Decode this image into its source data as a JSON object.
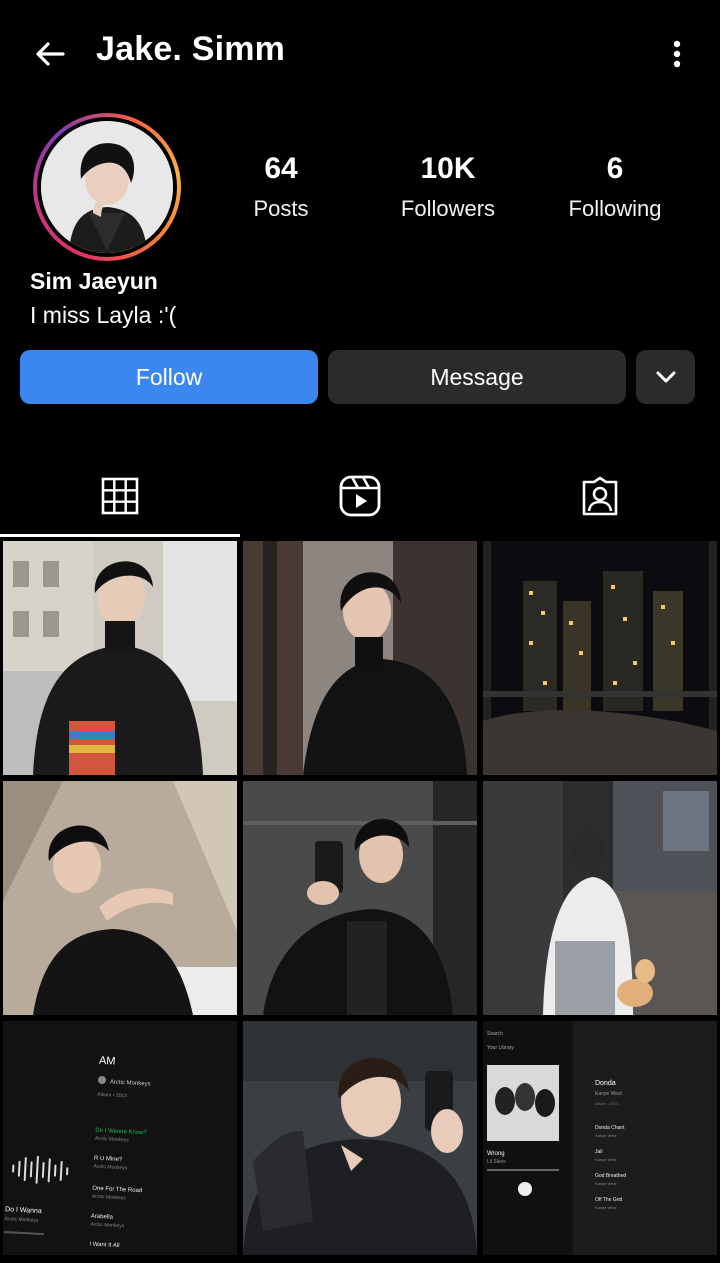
{
  "header": {
    "username": "Jake. Simm",
    "back_icon": "arrow-left-icon",
    "more_icon": "more-vertical-icon"
  },
  "profile": {
    "posts_count": "64",
    "posts_label": "Posts",
    "followers_count": "10K",
    "followers_label": "Followers",
    "following_count": "6",
    "following_label": "Following",
    "display_name": "Sim Jaeyun",
    "bio": "I miss Layla :'(",
    "story_ring_colors": [
      "#e1306c",
      "#833ab4",
      "#fcaf45"
    ]
  },
  "actions": {
    "follow_label": "Follow",
    "message_label": "Message",
    "follow_color": "#3a87f0"
  },
  "tabs": [
    {
      "name": "grid",
      "icon": "grid-icon",
      "active": true
    },
    {
      "name": "reels",
      "icon": "reels-icon",
      "active": false
    },
    {
      "name": "tagged",
      "icon": "tagged-user-icon",
      "active": false
    }
  ],
  "posts": [
    {
      "id": 1,
      "kind": "photo"
    },
    {
      "id": 2,
      "kind": "photo"
    },
    {
      "id": 3,
      "kind": "photo"
    },
    {
      "id": 4,
      "kind": "photo"
    },
    {
      "id": 5,
      "kind": "photo"
    },
    {
      "id": 6,
      "kind": "photo"
    },
    {
      "id": 7,
      "kind": "screenshot",
      "album": "AM",
      "artist": "Arctic Monkeys",
      "album_meta": "Album • 2013",
      "tracks": [
        {
          "title": "Do I Wanna Know?",
          "artist": "Arctic Monkeys"
        },
        {
          "title": "R U Mine?",
          "artist": "Arctic Monkeys"
        },
        {
          "title": "One For The Road",
          "artist": "Arctic Monkeys"
        },
        {
          "title": "Arabella",
          "artist": "Arctic Monkeys"
        },
        {
          "title": "I Want It All",
          "artist": ""
        }
      ],
      "now_playing": "Do I Wanna",
      "now_playing_artist": "Arctic Monkeys"
    },
    {
      "id": 8,
      "kind": "photo"
    },
    {
      "id": 9,
      "kind": "screenshot",
      "search": "Search",
      "library": "Your Library",
      "album": "Donda",
      "artist": "Kanye West",
      "album_meta": "Album • 2021",
      "track": "Wrong",
      "track_artist": "Lil Skies",
      "tracks": [
        {
          "title": "Donda Chant",
          "artist": "Kanye West"
        },
        {
          "title": "Jail",
          "artist": "Kanye West"
        },
        {
          "title": "God Breathed",
          "artist": "Kanye West"
        },
        {
          "title": "Off The Grid",
          "artist": "Kanye West"
        }
      ]
    }
  ]
}
